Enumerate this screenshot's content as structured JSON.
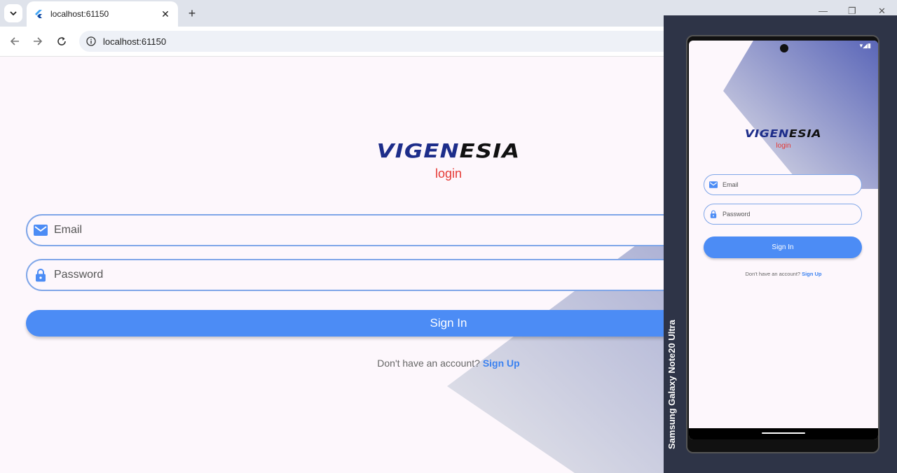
{
  "browser": {
    "tab_title": "localhost:61150",
    "url": "localhost:61150",
    "icons": {
      "tab_search": "chevron-down-icon",
      "favicon": "flutter-icon",
      "tab_close": "close-icon",
      "new_tab": "plus-icon",
      "back": "back-arrow-icon",
      "forward": "forward-arrow-icon",
      "reload": "reload-icon",
      "site_info": "info-icon"
    }
  },
  "login": {
    "logo_part1": "VIGEN",
    "logo_part2": "ESIA",
    "subtitle": "login",
    "email_placeholder": "Email",
    "password_placeholder": "Password",
    "signin_label": "Sign In",
    "no_account_text": "Don't have an account? ",
    "signup_label": "Sign Up"
  },
  "device": {
    "label": "Samsung Galaxy  Note20 Ultra",
    "status_icons": "▾◢▮"
  },
  "colors": {
    "accent": "#4c8cf5",
    "brand": "#1d2d8a",
    "subtitle": "#e53935",
    "background": "#fdf7fc"
  }
}
